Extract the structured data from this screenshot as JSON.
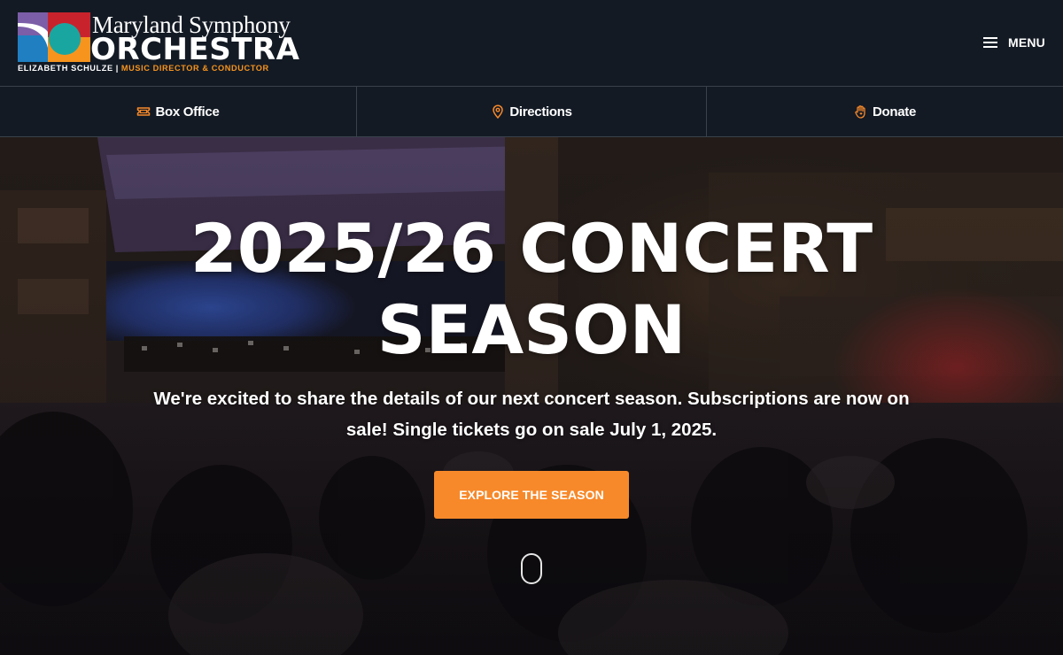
{
  "brand": {
    "name_line1": "Maryland Symphony",
    "name_line2": "ORCHESTRA",
    "director_name": "ELIZABETH SCHULZE",
    "separator": "|",
    "director_title": "MUSIC DIRECTOR & CONDUCTOR",
    "colors": {
      "purple": "#7b5ea7",
      "red": "#c8232c",
      "blue": "#1f7fc1",
      "teal": "#1aa6a0",
      "orange": "#f7941d"
    }
  },
  "header": {
    "menu_label": "MENU",
    "menu_icon": "hamburger-icon"
  },
  "utility_nav": [
    {
      "label": "Box Office",
      "icon": "ticket-icon"
    },
    {
      "label": "Directions",
      "icon": "map-pin-icon"
    },
    {
      "label": "Donate",
      "icon": "hand-heart-icon"
    }
  ],
  "hero": {
    "title_line1": "2025/26 CONCERT",
    "title_line2": "SEASON",
    "body": "We're excited to share the details of our next concert season. Subscriptions are now on sale! Single tickets go on sale July 1, 2025.",
    "cta_label": "EXPLORE THE SEASON",
    "scroll_icon": "mouse-scroll-icon"
  },
  "colors": {
    "header_bg": "#131a24",
    "accent": "#f7892a",
    "divider": "#3a414b"
  }
}
